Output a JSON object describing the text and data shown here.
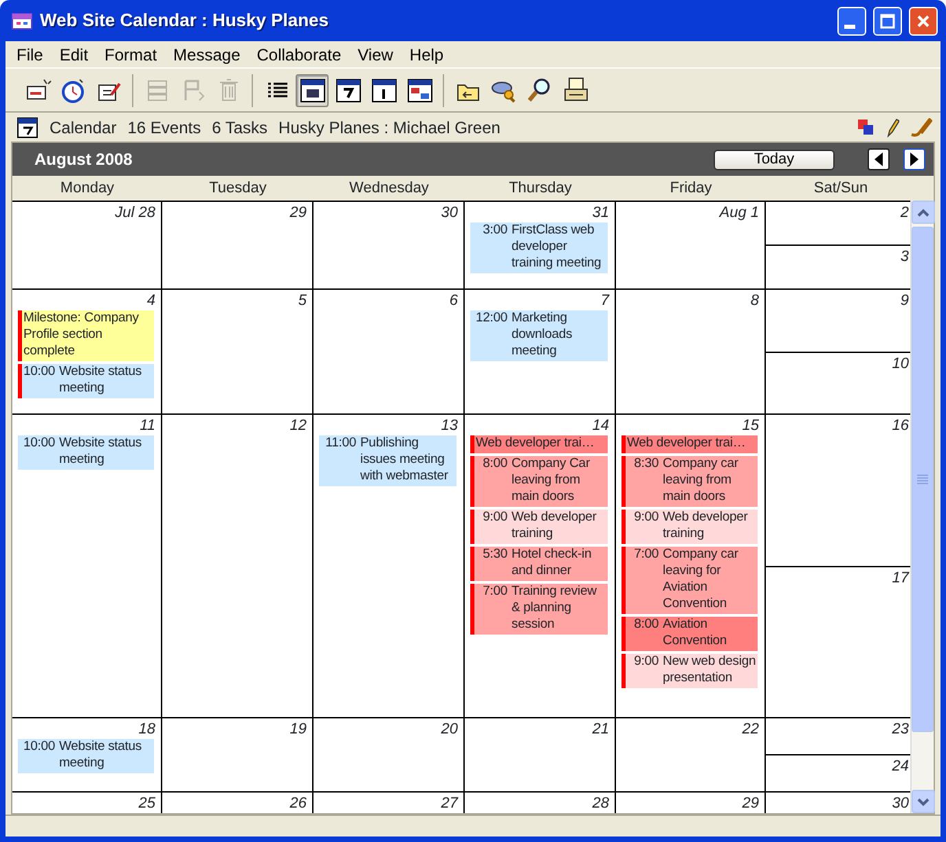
{
  "window": {
    "title": "Web Site Calendar : Husky Planes"
  },
  "menu": [
    "File",
    "Edit",
    "Format",
    "Message",
    "Collaborate",
    "View",
    "Help"
  ],
  "toolbar": [
    [
      {
        "disabled": false,
        "selected": false
      },
      {
        "disabled": false,
        "selected": false
      },
      {
        "disabled": false,
        "selected": false
      }
    ],
    [
      {
        "disabled": true,
        "selected": false
      },
      {
        "disabled": true,
        "selected": false
      },
      {
        "disabled": true,
        "selected": false
      }
    ],
    [
      {
        "disabled": false,
        "selected": false
      },
      {
        "disabled": false,
        "selected": true
      },
      {
        "disabled": false,
        "selected": false
      },
      {
        "disabled": false,
        "selected": false
      },
      {
        "disabled": false,
        "selected": false
      }
    ],
    [
      {
        "disabled": false,
        "selected": false
      },
      {
        "disabled": false,
        "selected": false
      },
      {
        "disabled": false,
        "selected": false
      },
      {
        "disabled": false,
        "selected": false
      }
    ]
  ],
  "info_bar": {
    "label": "Calendar",
    "events": "16 Events",
    "tasks": "6 Tasks",
    "owner": "Husky Planes : Michael Green"
  },
  "calendar": {
    "month": "August 2008",
    "today_button": "Today",
    "day_names": [
      "Monday",
      "Tuesday",
      "Wednesday",
      "Thursday",
      "Friday",
      "Sat/Sun"
    ],
    "weeks": [
      {
        "days": [
          {
            "date": "Jul 28"
          },
          {
            "date": "29"
          },
          {
            "date": "30"
          },
          {
            "date": "31",
            "events": [
              {
                "kind": "event",
                "time": "3:00",
                "title": "FirstClass web developer training meeting",
                "color": "#cce8ff",
                "flagged": false
              }
            ]
          },
          {
            "date": "Aug 1"
          }
        ],
        "weekend": [
          {
            "date": "2"
          },
          {
            "date": "3"
          }
        ]
      },
      {
        "days": [
          {
            "date": "4",
            "events": [
              {
                "kind": "milestone",
                "title": "Milestone: Company Profile section complete",
                "color": "#ffff99",
                "flagged": true
              },
              {
                "kind": "event",
                "time": "10:00",
                "title": "Website status meeting",
                "color": "#cce8ff",
                "flagged": true
              }
            ]
          },
          {
            "date": "5"
          },
          {
            "date": "6"
          },
          {
            "date": "7",
            "events": [
              {
                "kind": "event",
                "time": "12:00",
                "title": "Marketing downloads meeting",
                "color": "#cce8ff",
                "flagged": false
              }
            ]
          },
          {
            "date": "8"
          }
        ],
        "weekend": [
          {
            "date": "9"
          },
          {
            "date": "10"
          }
        ]
      },
      {
        "days": [
          {
            "date": "11",
            "events": [
              {
                "kind": "event",
                "time": "10:00",
                "title": "Website status meeting",
                "color": "#cce8ff",
                "flagged": false
              }
            ]
          },
          {
            "date": "12"
          },
          {
            "date": "13",
            "events": [
              {
                "kind": "event",
                "time": "11:00",
                "title": "Publishing issues meeting with webmaster",
                "color": "#cce8ff",
                "flagged": false
              }
            ]
          },
          {
            "date": "14",
            "events": [
              {
                "kind": "banner",
                "title": "Web developer trai…",
                "color": "#ff8080",
                "flagged": true
              },
              {
                "kind": "event",
                "time": "8:00",
                "title": "Company Car leaving from main doors",
                "color": "#ffa3a3",
                "flagged": true
              },
              {
                "kind": "event",
                "time": "9:00",
                "title": "Web developer training",
                "color": "#ffd9d9",
                "flagged": true
              },
              {
                "kind": "event",
                "time": "5:30",
                "title": "Hotel check-in and dinner",
                "color": "#ffa3a3",
                "flagged": true
              },
              {
                "kind": "event",
                "time": "7:00",
                "title": "Training review & planning session",
                "color": "#ffa3a3",
                "flagged": true
              }
            ]
          },
          {
            "date": "15",
            "events": [
              {
                "kind": "banner",
                "title": "Web developer trai…",
                "color": "#ff8080",
                "flagged": true
              },
              {
                "kind": "event",
                "time": "8:30",
                "title": "Company car leaving from main doors",
                "color": "#ffa3a3",
                "flagged": true
              },
              {
                "kind": "event",
                "time": "9:00",
                "title": "Web developer training",
                "color": "#ffd9d9",
                "flagged": true
              },
              {
                "kind": "event",
                "time": "7:00",
                "title": "Company car leaving for Aviation Convention",
                "color": "#ffa3a3",
                "flagged": true
              },
              {
                "kind": "event",
                "time": "8:00",
                "title": "Aviation Convention",
                "color": "#ff7f7f",
                "flagged": true
              },
              {
                "kind": "event",
                "time": "9:00",
                "title": "New web design presentation",
                "color": "#ffd9d9",
                "flagged": true
              }
            ]
          }
        ],
        "weekend": [
          {
            "date": "16"
          },
          {
            "date": "17"
          }
        ]
      },
      {
        "days": [
          {
            "date": "18",
            "events": [
              {
                "kind": "event",
                "time": "10:00",
                "title": "Website status meeting",
                "color": "#cce8ff",
                "flagged": false
              }
            ]
          },
          {
            "date": "19"
          },
          {
            "date": "20"
          },
          {
            "date": "21"
          },
          {
            "date": "22"
          }
        ],
        "weekend": [
          {
            "date": "23"
          },
          {
            "date": "24"
          }
        ]
      },
      {
        "days": [
          {
            "date": "25"
          },
          {
            "date": "26"
          },
          {
            "date": "27"
          },
          {
            "date": "28"
          },
          {
            "date": "29"
          }
        ],
        "weekend": [
          {
            "date": "30"
          }
        ]
      }
    ]
  }
}
